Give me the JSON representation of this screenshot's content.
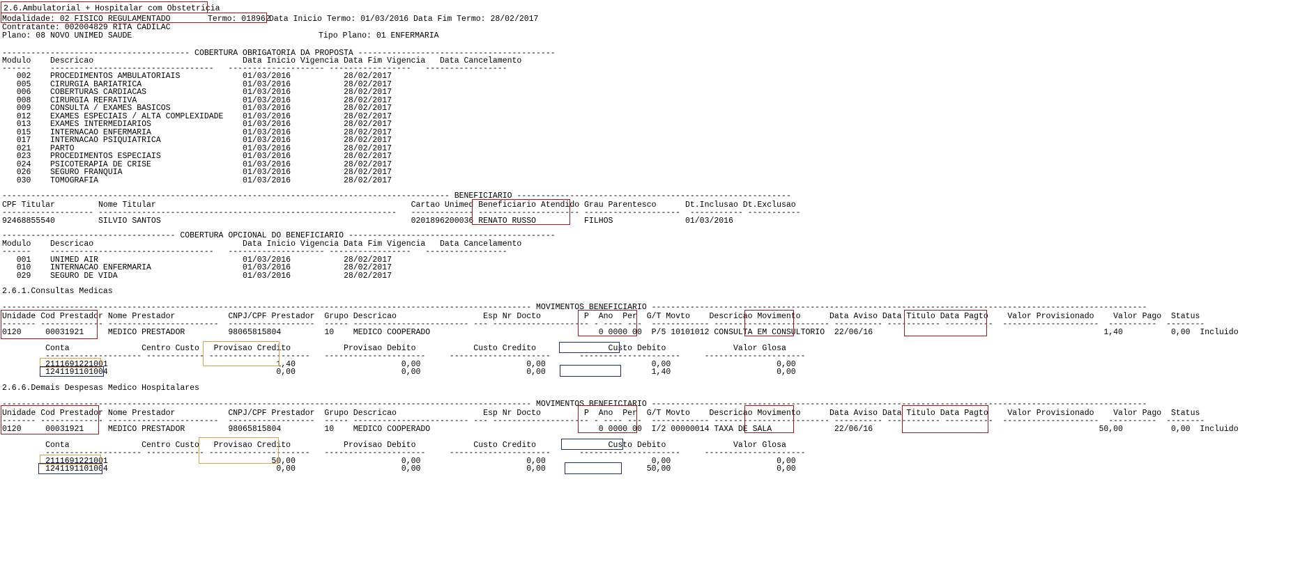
{
  "header": {
    "section_title": "2.6.Ambulatorial + Hospitalar com Obstetricia",
    "modalidade": "Modalidade: 02 FISICO REGULAMENTADO",
    "termo": "Termo: 018962",
    "termo_dates": "Data Inicio Termo: 01/03/2016 Data Fim Termo: 28/02/2017",
    "contratante": "Contratante: 002004829 RITA CADILAC",
    "plano": "Plano: 08 NOVO UNIMED SAUDE",
    "tipo_plano": "Tipo Plano: 01 ENFERMARIA"
  },
  "cobertura_obrigatoria": {
    "divider": "--------------------------------------- COBERTURA OBRIGATORIA DA PROPOSTA -----------------------------------------",
    "headers": "Modulo    Descricao                               Data Inicio Vigencia Data Fim Vigencia   Data Cancelamento",
    "underline": "------    ----------------------------------   -------------------- -----------------   -----------------",
    "rows": [
      "   002    PROCEDIMENTOS AMBULATORIAIS             01/03/2016           28/02/2017",
      "   005    CIRURGIA BARIATRICA                     01/03/2016           28/02/2017",
      "   006    COBERTURAS CARDIACAS                    01/03/2016           28/02/2017",
      "   008    CIRURGIA REFRATIVA                      01/03/2016           28/02/2017",
      "   009    CONSULTA / EXAMES BASICOS               01/03/2016           28/02/2017",
      "   012    EXAMES ESPECIAIS / ALTA COMPLEXIDADE    01/03/2016           28/02/2017",
      "   013    EXAMES INTERMEDIARIOS                   01/03/2016           28/02/2017",
      "   015    INTERNACAO ENFERMARIA                   01/03/2016           28/02/2017",
      "   017    INTERNACAO PSIQUIATRICA                 01/03/2016           28/02/2017",
      "   021    PARTO                                   01/03/2016           28/02/2017",
      "   023    PROCEDIMENTOS ESPECIAIS                 01/03/2016           28/02/2017",
      "   024    PSICOTERAPIA DE CRISE                   01/03/2016           28/02/2017",
      "   026    SEGURO FRANQUIA                         01/03/2016           28/02/2017",
      "   030    TOMOGRAFIA                              01/03/2016           28/02/2017"
    ]
  },
  "beneficiario": {
    "divider": "--------------------------------------------------------------------------------------------- BENEFICIARIO ---------------------------------------------------------",
    "headers": "CPF Titular         Nome Titular                                                     Cartao Unimed Beneficiario Atendido Grau Parentesco      Dt.Inclusao Dt.Exclusao",
    "underline": "------------------- --------------------------------------------------------------   ------------- --------------------- --------------------  ----------- -----------",
    "row": "92468855540         SILVIO SANTOS                                                    0201896200036 RENATO RUSSO          FILHOS               01/03/2016"
  },
  "cobertura_opcional": {
    "divider": "------------------------------------ COBERTURA OPCIONAL DO BENEFICIARIO -------------------------------------------",
    "headers": "Modulo    Descricao                               Data Inicio Vigencia Data Fim Vigencia   Data Cancelamento",
    "underline": "------    ----------------------------------   -------------------- -----------------   -----------------",
    "rows": [
      "   001    UNIMED AIR                              01/03/2016           28/02/2017",
      "   010    INTERNACAO ENFERMARIA                   01/03/2016           28/02/2017",
      "   029    SEGURO DE VIDA                          01/03/2016           28/02/2017"
    ]
  },
  "consultas": {
    "section_title": "2.6.1.Consultas Medicas",
    "divider": "-------------------------------------------------------------------------------------------------------------- MOVIMENTOS BENEFICIARIO -------------------------------------------------------------------------------------------------------",
    "headers": "Unidade Cod Prestador Nome Prestador           CNPJ/CPF Prestador  Grupo Descricao                  Esp Nr Docto         P  Ano  Per  G/T Movto    Descricao Movimento      Data Aviso Data Titulo Data Pagto    Valor Provisionado    Valor Pago  Status",
    "underline": "------- ------------- -----------------------  ------------------  ----- ------------------------ --- -------------------- - ---- ---  ------------ ------------------------ ---------- ----------- ----------  --------------------  ----------  --------",
    "row": "0120     00031921     MEDICO PRESTADOR         98065815804         10    MEDICO COOPERADO                                   0 0000 00  P/5 10101012 CONSULTA EM CONSULTORIO  22/06/16                                                1,40          0,00  Incluido",
    "sub_headers": "         Conta               Centro Custo   Provisao Credito           Provisao Debito            Custo Credito               Custo Debito              Valor Glosa",
    "sub_underline": "         -------------------- ------------ ---------------------   ---------------------     ---------------------      ---------------------     ---------------------",
    "sub_rows": [
      "         2111691221001                                   1,40                      0,00                      0,00                      0,00                      0,00",
      "         1241191101004                                   0,00                      0,00                      0,00                      1,40                      0,00"
    ]
  },
  "demais": {
    "section_title": "2.6.6.Demais Despesas Medico Hospitalares",
    "divider": "-------------------------------------------------------------------------------------------------------------- MOVIMENTOS BENEFICIARIO -------------------------------------------------------------------------------------------------------",
    "headers": "Unidade Cod Prestador Nome Prestador           CNPJ/CPF Prestador  Grupo Descricao                  Esp Nr Docto         P  Ano  Per  G/T Movto    Descricao Movimento      Data Aviso Data Titulo Data Pagto    Valor Provisionado    Valor Pago  Status",
    "underline": "------- ------------- -----------------------  ------------------  ----- ------------------------ --- -------------------- - ---- ---  ------------ ------------------------ ---------- ----------- ----------  --------------------  ----------  --------",
    "row": "0120     00031921     MEDICO PRESTADOR         98065815804         10    MEDICO COOPERADO                                   0 0000 00  I/2 00000014 TAXA DE SALA             22/06/16                                               50,00          0,00  Incluido",
    "sub_headers": "         Conta               Centro Custo   Provisao Credito           Provisao Debito            Custo Credito               Custo Debito              Valor Glosa",
    "sub_underline": "         -------------------- ------------ ---------------------   ---------------------     ---------------------      ---------------------     ---------------------",
    "sub_rows": [
      "         2111691221001                                  50,00                      0,00                      0,00                      0,00                      0,00",
      "         1241191101004                                   0,00                      0,00                      0,00                     50,00                      0,00"
    ]
  }
}
